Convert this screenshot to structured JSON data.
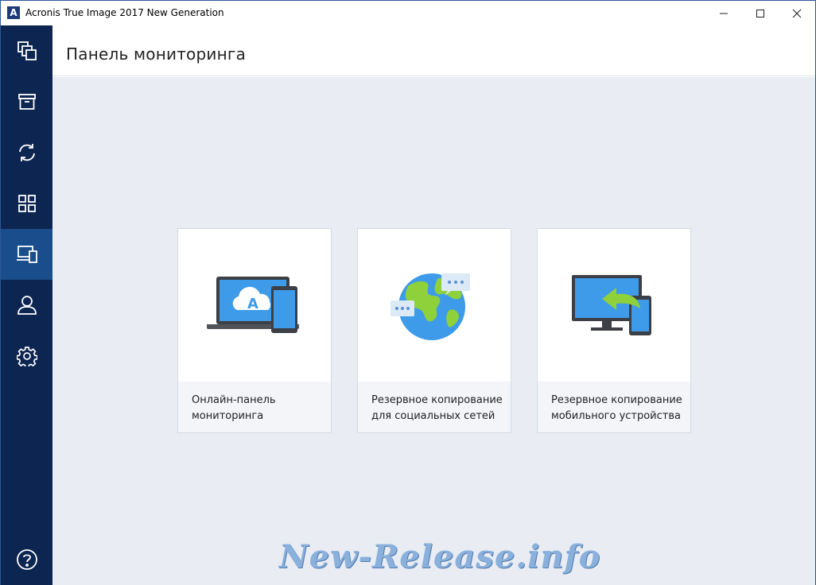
{
  "window": {
    "title": "Acronis True Image 2017 New Generation",
    "logo_letter": "A",
    "controls": {
      "minimize_icon": "minimize-icon",
      "maximize_icon": "maximize-icon",
      "close_icon": "close-icon"
    }
  },
  "sidebar": {
    "items": [
      {
        "icon": "backup-icon",
        "active": false
      },
      {
        "icon": "archive-icon",
        "active": false
      },
      {
        "icon": "sync-icon",
        "active": false
      },
      {
        "icon": "tools-grid-icon",
        "active": false
      },
      {
        "icon": "dashboard-devices-icon",
        "active": true
      },
      {
        "icon": "account-icon",
        "active": false
      },
      {
        "icon": "settings-gear-icon",
        "active": false
      }
    ],
    "help_icon": "help-icon"
  },
  "header": {
    "title": "Панель мониторинга"
  },
  "cards": [
    {
      "line1": "Онлайн-панель",
      "line2": "мониторинга",
      "icon": "laptop-phone-cloud-icon"
    },
    {
      "line1": "Резервное копирование",
      "line2": "для социальных сетей",
      "icon": "globe-chat-icon"
    },
    {
      "line1": "Резервное копирование",
      "line2": "мобильного устройства",
      "icon": "monitor-phone-arrow-icon"
    }
  ],
  "colors": {
    "sidebar_bg": "#0d2651",
    "sidebar_active": "#1a4d8c",
    "content_bg": "#e9edf3",
    "accent_blue": "#3d9be9",
    "accent_green": "#8fd13a"
  },
  "watermark": "New-Release.info"
}
